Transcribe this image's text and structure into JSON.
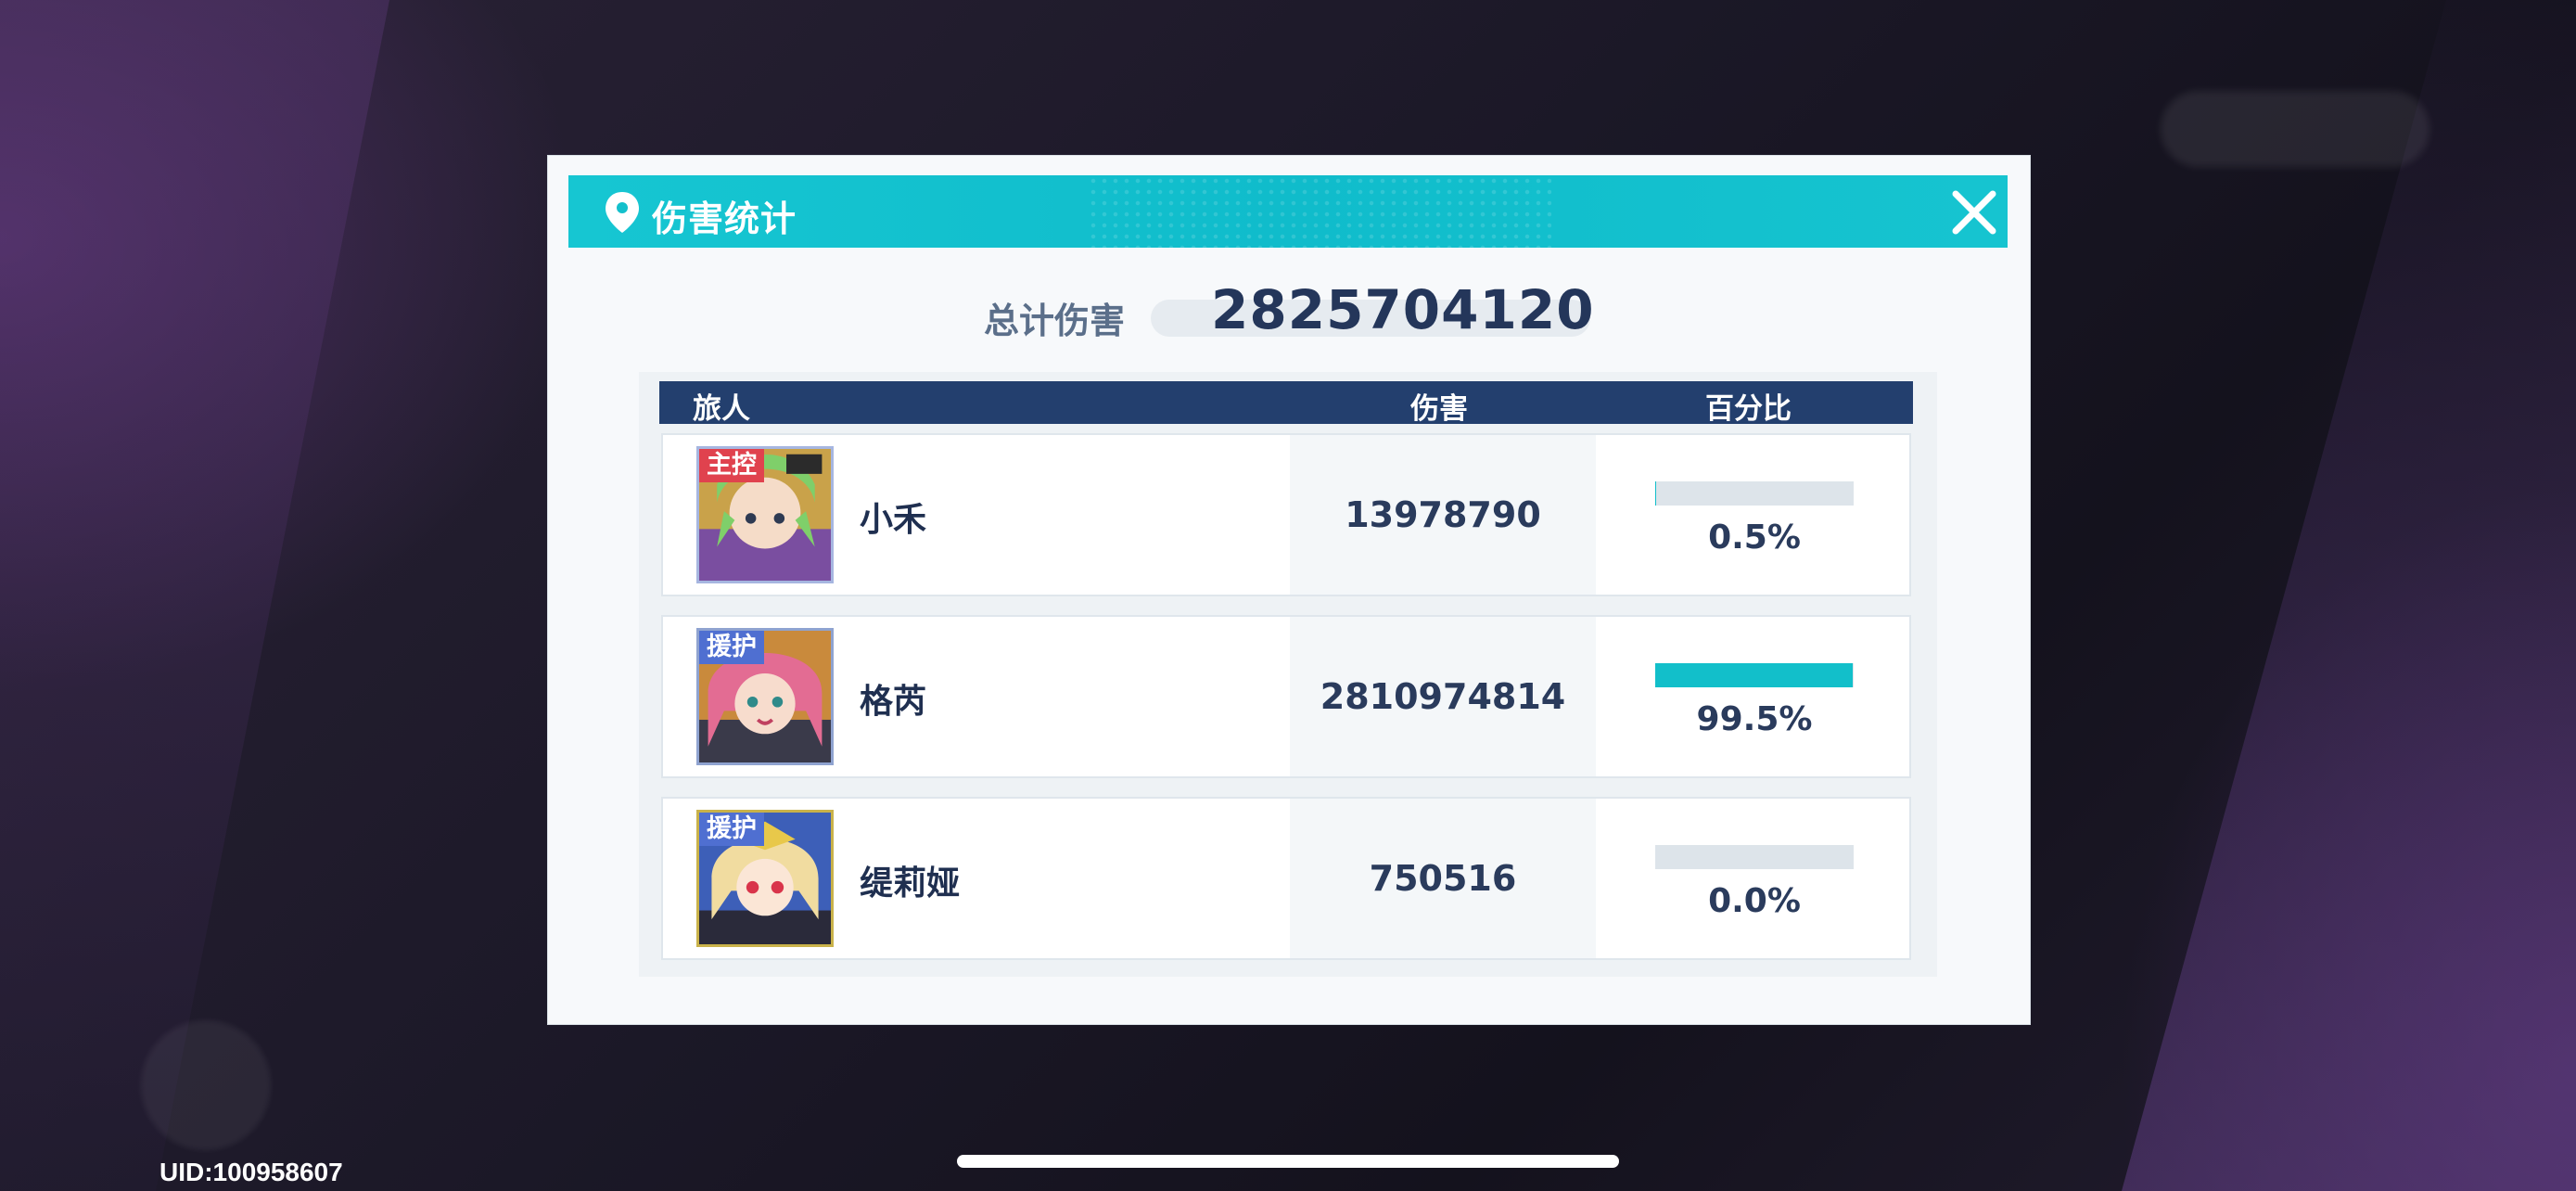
{
  "dialog": {
    "title": "伤害统计",
    "total_label": "总计伤害",
    "total_value": "2825704120"
  },
  "table": {
    "headers": {
      "name": "旅人",
      "damage": "伤害",
      "percent": "百分比"
    },
    "rows": [
      {
        "role": "主控",
        "role_color": "#e0424e",
        "name": "小禾",
        "damage": "13978790",
        "percent": "0.5%",
        "percent_value": 0.5
      },
      {
        "role": "援护",
        "role_color": "#4f6fd1",
        "name": "格芮",
        "damage": "2810974814",
        "percent": "99.5%",
        "percent_value": 99.5
      },
      {
        "role": "援护",
        "role_color": "#4f6fd1",
        "name": "缇莉娅",
        "damage": "750516",
        "percent": "0.0%",
        "percent_value": 0.0
      }
    ]
  },
  "footer": {
    "uid": "UID:100958607"
  },
  "icons": {
    "header": "location-pin-icon",
    "close": "close-icon"
  },
  "colors": {
    "header_accent": "#12c2ce",
    "table_header": "#233f6e",
    "bar_fill": "#12bfca"
  }
}
